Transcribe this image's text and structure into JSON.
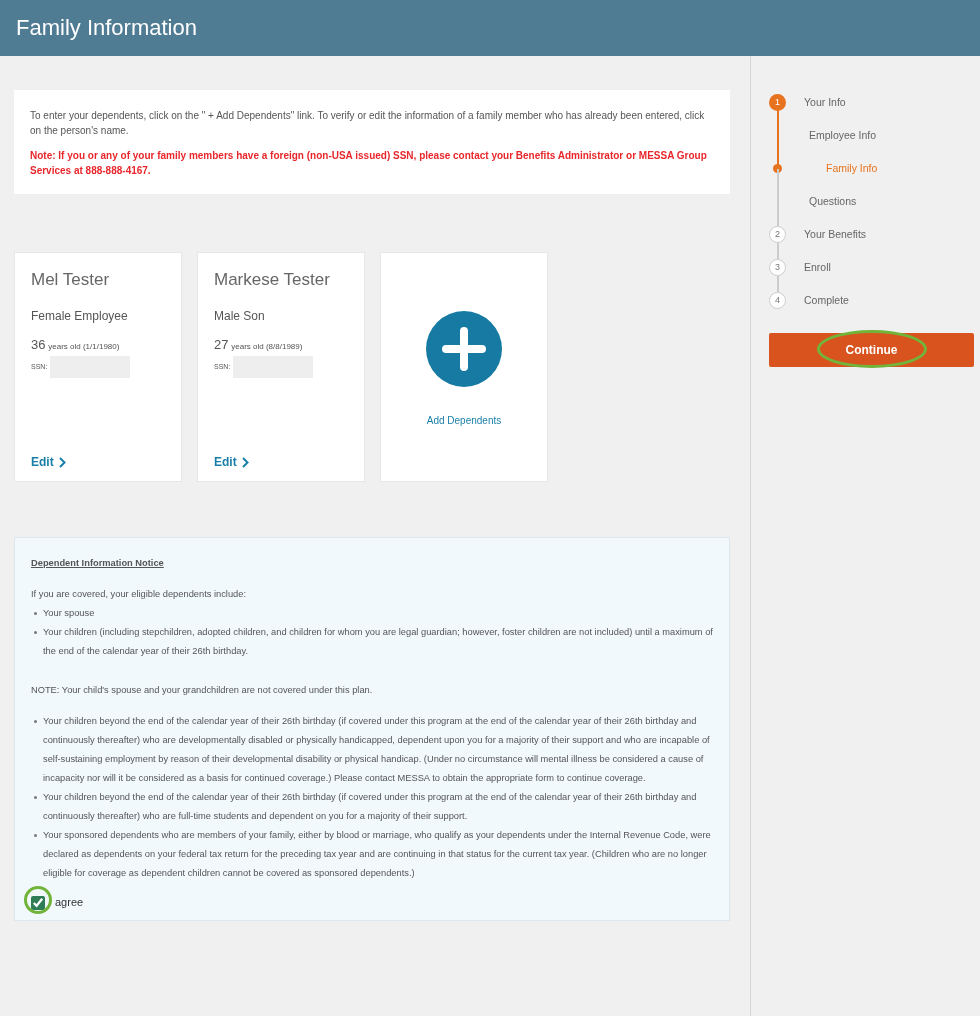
{
  "header": {
    "title": "Family Information"
  },
  "intro": {
    "text": "To enter your dependents, click on the \" + Add Dependents\" link. To verify or edit the information of a family member who has already been entered, click on the person's name.",
    "note": "Note: If you or any of your family members have a foreign (non-USA issued) SSN, please contact your Benefits Administrator or MESSA Group Services at 888-888-4167."
  },
  "people": [
    {
      "name": "Mel Tester",
      "relation": "Female Employee",
      "age": "36",
      "age_note": "years old (1/1/1980)",
      "ssn_label": "SSN:",
      "edit_label": "Edit"
    },
    {
      "name": "Markese Tester",
      "relation": "Male Son",
      "age": "27",
      "age_note": "years old (8/8/1989)",
      "ssn_label": "SSN:",
      "edit_label": "Edit"
    }
  ],
  "add_card": {
    "label": "Add Dependents"
  },
  "notice": {
    "heading": "Dependent Information Notice",
    "intro": "If you are covered, your eligible dependents include:",
    "bullets_1": [
      "Your spouse",
      "Your children (including stepchildren, adopted children, and children for whom you are legal guardian; however, foster children are not included) until a maximum of the end of the calendar year of their 26th birthday."
    ],
    "note": "NOTE: Your child's spouse and your grandchildren are not covered under this plan.",
    "bullets_2": [
      "Your children beyond the end of the calendar year of their 26th birthday (if covered under this program at the end of the calendar year of their 26th birthday and continuously thereafter) who are developmentally disabled or physically handicapped, dependent upon you for a majority of their support and who are incapable of self-sustaining employment by reason of their developmental disability or physical handicap. (Under no circumstance will mental illness be considered a cause of incapacity nor will it be considered as a basis for continued coverage.) Please contact MESSA to obtain the appropriate form to continue coverage.",
      "Your children beyond the end of the calendar year of their 26th birthday (if covered under this program at the end of the calendar year of their 26th birthday and continuously thereafter) who are full-time students and dependent on you for a majority of their support.",
      "Your sponsored dependents who are members of your family, either by blood or marriage, who qualify as your dependents under the Internal Revenue Code, were declared as dependents on your federal tax return for the preceding tax year and are continuing in that status for the current tax year. (Children who are no longer eligible for coverage as dependent children cannot be covered as sponsored dependents.)"
    ],
    "agree": {
      "label": "agree",
      "checked": true,
      "highlighted": true
    }
  },
  "steps": [
    {
      "number": "1",
      "label": "Your Info",
      "selected": true,
      "children": [
        {
          "label": "Employee Info",
          "selected": false
        },
        {
          "label": "Family Info",
          "selected": true
        },
        {
          "label": "Questions",
          "selected": false
        }
      ]
    },
    {
      "number": "2",
      "label": "Your Benefits",
      "selected": false
    },
    {
      "number": "3",
      "label": "Enroll",
      "selected": false
    },
    {
      "number": "4",
      "label": "Complete",
      "selected": false
    }
  ],
  "continue_button": {
    "label": "Continue",
    "highlighted": true
  }
}
